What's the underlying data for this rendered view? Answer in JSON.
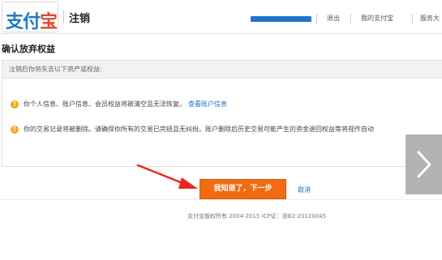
{
  "header": {
    "logo_text_a": "支付",
    "logo_text_b": "宝",
    "section_title": "注销",
    "nav": [
      "退出",
      "我的支付宝",
      "服务大"
    ]
  },
  "page": {
    "heading": "确认放弃权益"
  },
  "panel": {
    "head": "注销后你将失去以下资产或权益:",
    "items": [
      {
        "text": "你个人信息、账户信息、会员权益将被清空且无法恢复。",
        "link": "查看账户信息"
      },
      {
        "text": "你的交易记录将被删除。请确保你所有的交易已完结且无纠纷。账户删除后历史交易可能产生的资金退回权益等将视作自动",
        "link": ""
      }
    ]
  },
  "actions": {
    "confirm_label": "我知道了，下一步",
    "cancel_label": "取消"
  },
  "footer": {
    "text": "支付宝版权所有 2004-2015 ICP证：浙B2-20120045"
  },
  "colors": {
    "brand_blue": "#1a78c8",
    "confirm_orange": "#f26a11",
    "warn_yellow": "#f2a81c",
    "annotation_red": "#e8271f"
  }
}
